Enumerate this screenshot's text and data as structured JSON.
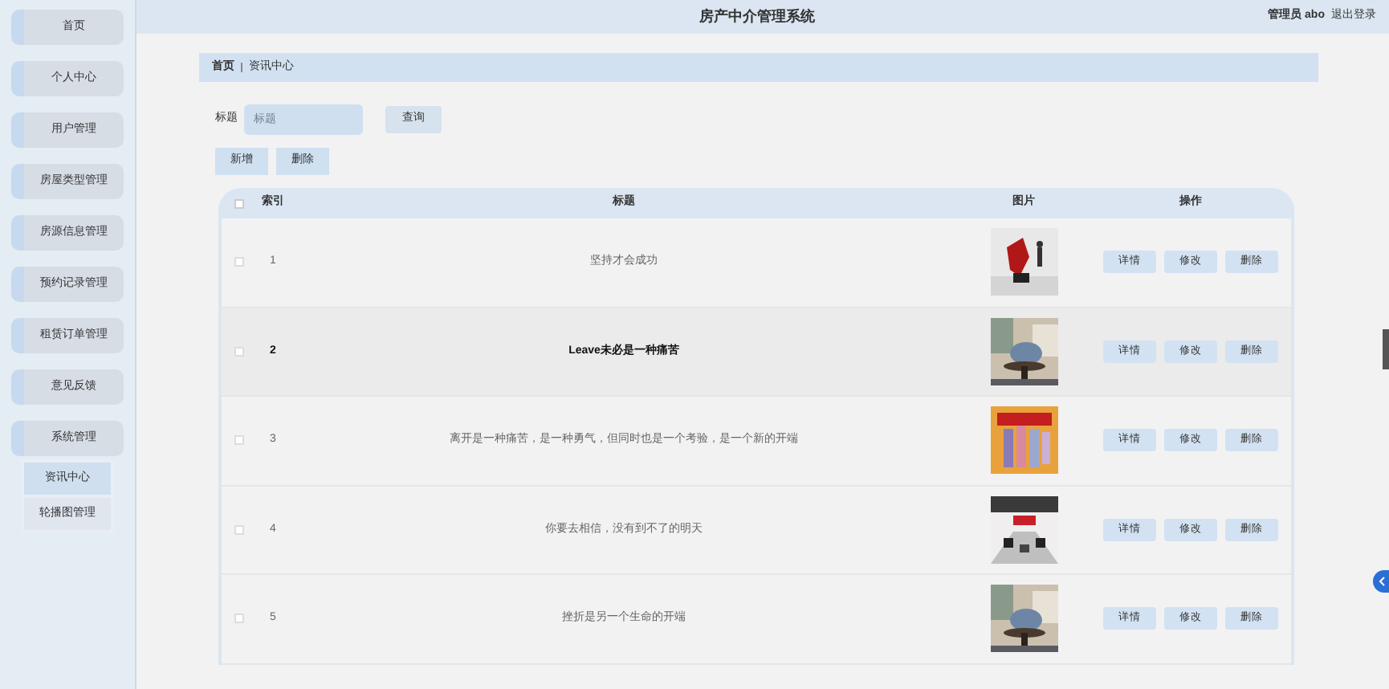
{
  "header": {
    "title": "房产中介管理系统",
    "user": "管理员 abo",
    "logout": "退出登录"
  },
  "sidebar": {
    "items": [
      {
        "label": "首页"
      },
      {
        "label": "个人中心"
      },
      {
        "label": "用户管理"
      },
      {
        "label": "房屋类型管理"
      },
      {
        "label": "房源信息管理"
      },
      {
        "label": "预约记录管理"
      },
      {
        "label": "租赁订单管理"
      },
      {
        "label": "意见反馈"
      },
      {
        "label": "系统管理",
        "expanded": true,
        "children": [
          {
            "label": "资讯中心",
            "selected": true
          },
          {
            "label": "轮播图管理",
            "selected": false
          }
        ]
      }
    ]
  },
  "breadcrumb": [
    {
      "label": "首页"
    },
    {
      "label": "资讯中心"
    }
  ],
  "search": {
    "label": "标题",
    "placeholder": "标题",
    "button": "查询"
  },
  "actions": [
    "新增",
    "删除"
  ],
  "table": {
    "all_checked": false,
    "columns": [
      "索引",
      "标题",
      "图片",
      "操作"
    ],
    "rows": [
      {
        "index": "1",
        "title": "坚持才会成功",
        "hovered": false,
        "checked": false,
        "picture": {
          "kind": "picture"
        },
        "buttons": [
          "详情",
          "修改",
          "删除"
        ]
      },
      {
        "index": "2",
        "title": "Leave未必是一种痛苦",
        "hovered": true,
        "checked": false,
        "picture": {
          "kind": "picture"
        },
        "buttons": [
          "详情",
          "修改",
          "删除"
        ]
      },
      {
        "index": "3",
        "title": "离开是一种痛苦，是一种勇气，但同时也是一个考验，是一个新的开端",
        "hovered": false,
        "checked": false,
        "picture": {
          "kind": "picture"
        },
        "buttons": [
          "详情",
          "修改",
          "删除"
        ]
      },
      {
        "index": "4",
        "title": "你要去相信，没有到不了的明天",
        "hovered": false,
        "checked": false,
        "picture": {
          "kind": "picture"
        },
        "buttons": [
          "详情",
          "修改",
          "删除"
        ]
      },
      {
        "index": "5",
        "title": "挫折是另一个生命的开端",
        "hovered": false,
        "checked": false,
        "picture": {
          "kind": "picture"
        },
        "buttons": [
          "详情",
          "修改",
          "删除"
        ]
      }
    ]
  }
}
